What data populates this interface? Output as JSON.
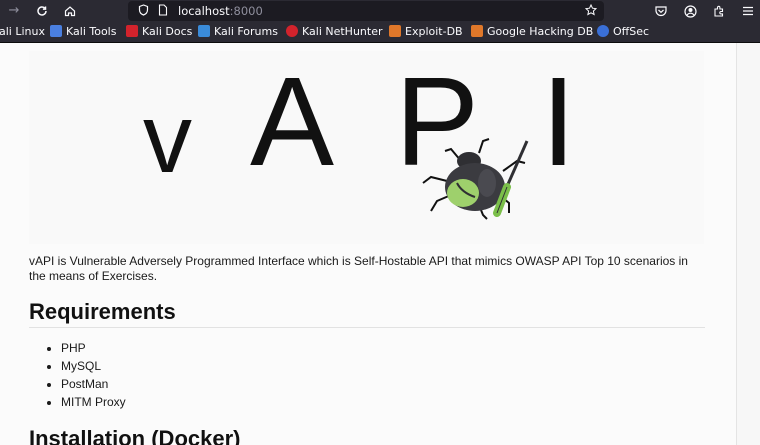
{
  "browser": {
    "url_host": "localhost",
    "url_port": ":8000",
    "icons": {
      "back": "arrow-left-icon",
      "reload": "reload-icon",
      "home": "home-icon",
      "tracking": "shield-icon",
      "page": "page-icon",
      "bookmark_star": "star-icon",
      "pocket": "pocket-icon",
      "account": "account-icon",
      "extensions": "extensions-icon",
      "menu": "menu-icon"
    }
  },
  "bookmarks": [
    {
      "label": "ali Linux",
      "icon": "kali-icon",
      "color": "#3b6fd1"
    },
    {
      "label": "Kali Tools",
      "icon": "kali-tools-icon",
      "color": "#4a7fe0"
    },
    {
      "label": "Kali Docs",
      "icon": "kali-docs-icon",
      "color": "#d3232c"
    },
    {
      "label": "Kali Forums",
      "icon": "kali-forums-icon",
      "color": "#3a8bd9"
    },
    {
      "label": "Kali NetHunter",
      "icon": "nethunter-icon",
      "color": "#d3232c"
    },
    {
      "label": "Exploit-DB",
      "icon": "exploit-db-icon",
      "color": "#e0782a"
    },
    {
      "label": "Google Hacking DB",
      "icon": "ghdb-icon",
      "color": "#e0782a"
    },
    {
      "label": "OffSec",
      "icon": "offsec-icon",
      "color": "#3a6fd6"
    }
  ],
  "page": {
    "logo": {
      "letters": [
        "v",
        "A",
        "P",
        "I"
      ],
      "icon": "bug-screwdriver-icon"
    },
    "intro": "vAPI is Vulnerable Adversely Programmed Interface which is Self-Hostable API that mimics OWASP API Top 10 scenarios in the means of Exercises.",
    "requirements_heading": "Requirements",
    "requirements": [
      "PHP",
      "MySQL",
      "PostMan",
      "MITM Proxy"
    ],
    "installation_heading": "Installation (Docker)"
  }
}
